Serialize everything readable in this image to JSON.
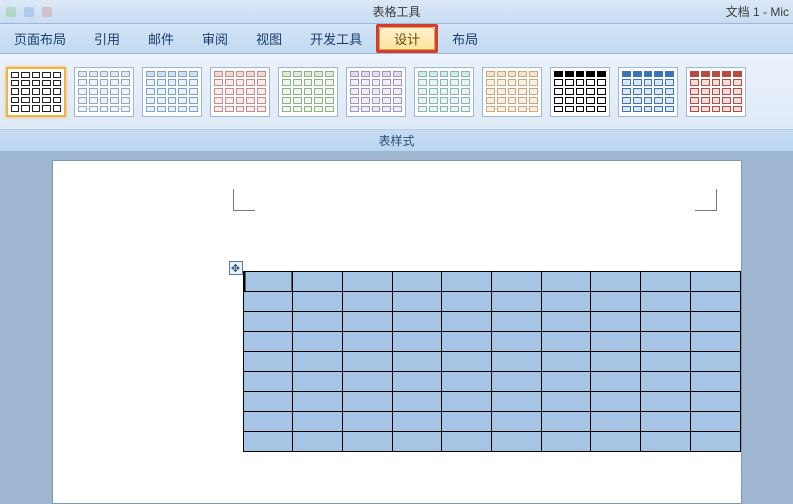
{
  "title": {
    "context_tab": "表格工具",
    "doc_title": "文档 1 - Mic"
  },
  "ribbon": {
    "tabs": {
      "page_layout": "页面布局",
      "references": "引用",
      "mailings": "邮件",
      "review": "审阅",
      "view": "视图",
      "developer": "开发工具",
      "design": "设计",
      "layout": "布局"
    }
  },
  "gallery": {
    "section_label": "表样式",
    "styles": [
      {
        "name": "plain-grid",
        "header_bg": "#ffffff",
        "body_bg": "#ffffff",
        "border": "#222222",
        "selected": true
      },
      {
        "name": "light-blue-1",
        "header_bg": "#dfe9f5",
        "body_bg": "#eef4fb",
        "border": "#90a8c6",
        "selected": false
      },
      {
        "name": "light-blue-2",
        "header_bg": "#cfe1f3",
        "body_bg": "#e8f0f9",
        "border": "#7ea4cc",
        "selected": false
      },
      {
        "name": "light-red",
        "header_bg": "#f2d8d6",
        "body_bg": "#f9ecec",
        "border": "#c58c88",
        "selected": false
      },
      {
        "name": "light-green",
        "header_bg": "#dcebd7",
        "body_bg": "#eef5eb",
        "border": "#8fb186",
        "selected": false
      },
      {
        "name": "light-purple",
        "header_bg": "#e3dcee",
        "body_bg": "#f1edf7",
        "border": "#a294c0",
        "selected": false
      },
      {
        "name": "light-teal",
        "header_bg": "#d4e9ec",
        "body_bg": "#eaf4f6",
        "border": "#86b4ba",
        "selected": false
      },
      {
        "name": "light-orange",
        "header_bg": "#f4e3cf",
        "body_bg": "#faf1e6",
        "border": "#cca777",
        "selected": false
      },
      {
        "name": "dark-header",
        "header_bg": "#000000",
        "body_bg": "#ffffff",
        "border": "#000000",
        "selected": false
      },
      {
        "name": "blue-header",
        "header_bg": "#3b74b9",
        "body_bg": "#dbe7f4",
        "border": "#3b74b9",
        "selected": false
      },
      {
        "name": "red-header",
        "header_bg": "#b94a3f",
        "body_bg": "#f2dfdd",
        "border": "#b94a3f",
        "selected": false
      }
    ]
  },
  "document": {
    "move_handle_glyph": "✥",
    "table": {
      "rows": 9,
      "cols": 10,
      "cell_bg": "#a6c5e4",
      "border": "#000000"
    }
  }
}
